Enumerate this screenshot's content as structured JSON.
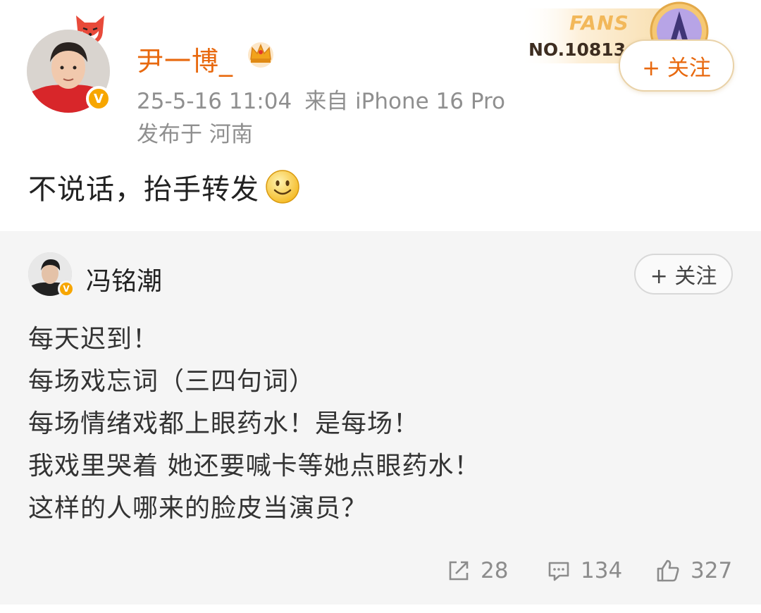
{
  "post": {
    "username": "尹一博_",
    "timestamp": "25-5-16 11:04",
    "source": "来自 iPhone 16 Pro",
    "location": "发布于 河南",
    "text": "不说话，抬手转发",
    "follow_label": "+ 关注",
    "fans_badge": {
      "label": "FANS",
      "number": "NO.10813"
    }
  },
  "repost": {
    "author": "冯铭潮",
    "follow_label": "+ 关注",
    "lines": [
      "每天迟到！",
      "每场戏忘词（三四句词）",
      "每场情绪戏都上眼药水！是每场！",
      "我戏里哭着 她还要喊卡等她点眼药水！",
      "这样的人哪来的脸皮当演员？"
    ],
    "stats": {
      "reposts": "28",
      "comments": "134",
      "likes": "327"
    }
  },
  "icons": {
    "verified": "v-badge-icon",
    "crown": "crown-icon",
    "smile": "smile-emoji-icon",
    "repost": "share-icon",
    "comment": "comment-icon",
    "like": "thumbs-up-icon"
  },
  "colors": {
    "username": "#e8690f",
    "meta": "#8f8f8f",
    "verified": "#f7a600",
    "repost_bg": "#f5f5f5"
  }
}
